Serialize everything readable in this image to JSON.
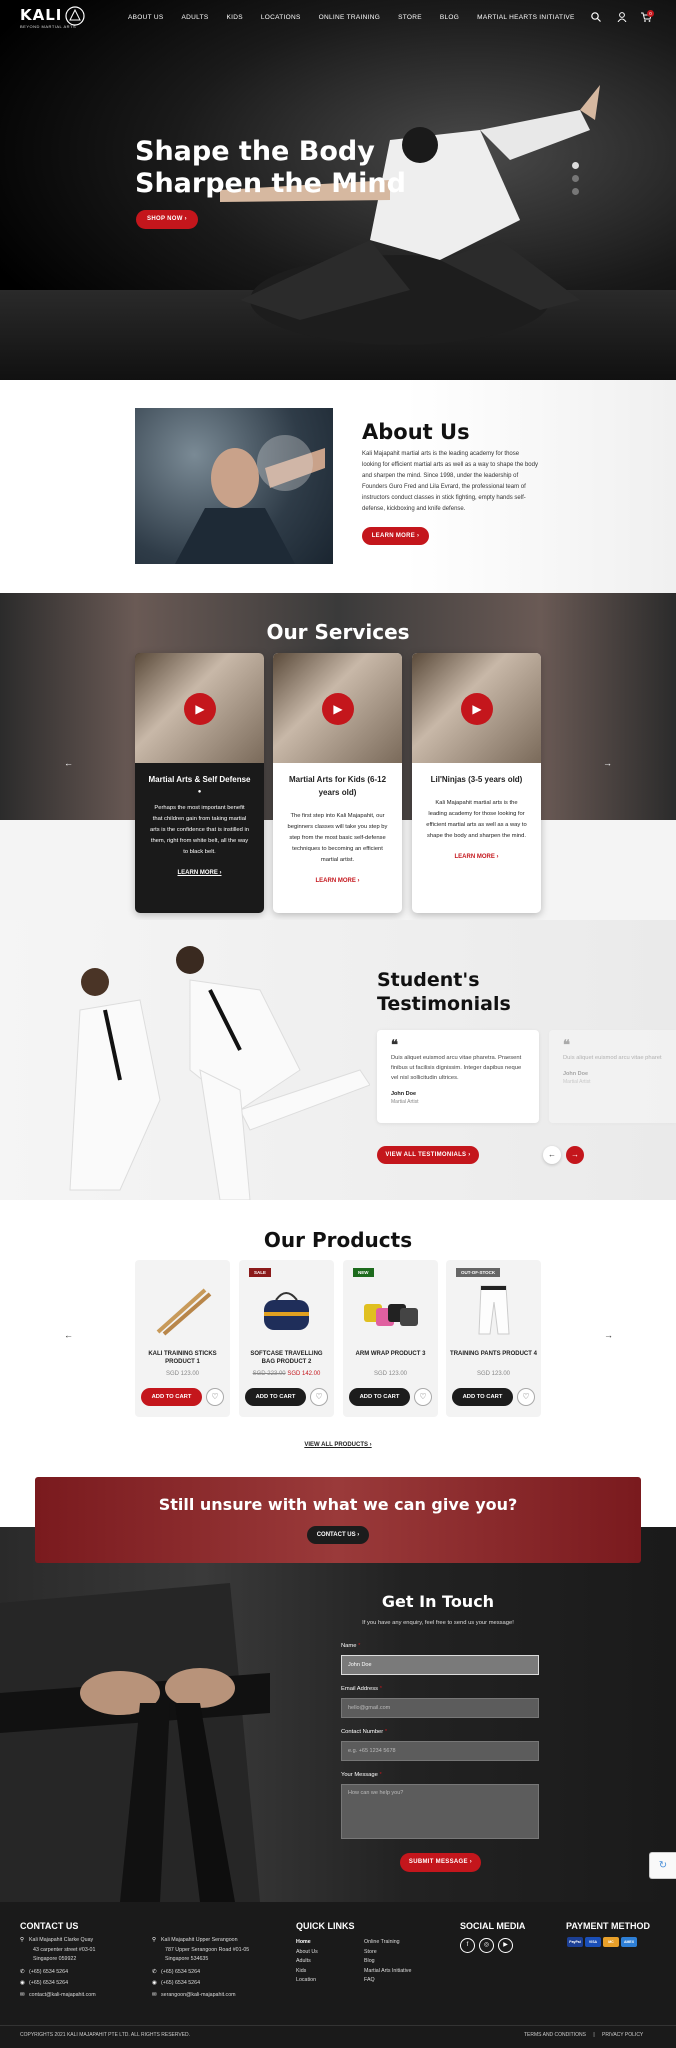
{
  "header": {
    "logo_main": "KALI",
    "logo_sub": "BEYOND MARTIAL ARTS",
    "nav": [
      "ABOUT US",
      "ADULTS",
      "KIDS",
      "LOCATIONS",
      "ONLINE TRAINING",
      "STORE",
      "BLOG",
      "MARTIAL HEARTS INITIATIVE"
    ],
    "cart_count": "0",
    "icons": [
      "search-icon",
      "user-icon",
      "cart-icon"
    ]
  },
  "hero": {
    "title_line1": "Shape the Body",
    "title_line2": "Sharpen the Mind",
    "button": "SHOP NOW ›"
  },
  "about": {
    "title": "About Us",
    "text": "Kali Majapahit martial arts is the leading academy for those looking for efficient martial arts as well as a way to shape the body and sharpen the mind. Since 1998, under the leadership of Founders Guro Fred and Lila Evrard, the professional team of instructors conduct classes in stick fighting, empty hands self-defense, kickboxing and knife defense.",
    "button": "LEARN MORE ›"
  },
  "services": {
    "title": "Our Services",
    "cards": [
      {
        "title": "Martial Arts & Self Defense",
        "text": "Perhaps the most important benefit that children gain from taking martial arts is the confidence that is instilled in them, right from white belt, all the way to black belt.",
        "link": "LEARN MORE ›"
      },
      {
        "title": "Martial Arts for Kids (6-12 years old)",
        "text": "The first step into Kali Majapahit, our beginners classes will take you step by step from the most basic self-defense techniques to becoming an efficient martial artist.",
        "link": "LEARN MORE ›"
      },
      {
        "title": "Lil'Ninjas (3-5 years old)",
        "text": "Kali Majapahit martial arts is the leading academy for those looking for efficient martial arts as well as a way to shape the body and sharpen the mind.",
        "link": "LEARN MORE ›"
      }
    ]
  },
  "testimonials": {
    "title": "Student's Testimonials",
    "items": [
      {
        "text": "Duis aliquet euismod arcu vitae pharetra. Praesent finibus ut facilisis dignissim. Integer dapibus neque vel nisl sollicitudin ultrices.",
        "name": "John Doe",
        "role": "Martial Artist"
      },
      {
        "text": "Duis aliquet euismod arcu vitae pharetra. Praesent finibus ut facilisis dignissim. Integer dapibus neque vel nisl sollicitudin ultrices.",
        "name": "John Doe",
        "role": "Martial Artist"
      }
    ],
    "button": "VIEW ALL TESTIMONIALS ›"
  },
  "products": {
    "title": "Our Products",
    "items": [
      {
        "name": "KALI TRAINING STICKS PRODUCT 1",
        "badge": "",
        "old_price": "",
        "price": "SGD 123.00",
        "button": "ADD TO CART"
      },
      {
        "name": "SOFTCASE TRAVELLING BAG PRODUCT 2",
        "badge": "SALE",
        "old_price": "SGD 223.00",
        "price": "SGD 142.00",
        "button": "ADD TO CART"
      },
      {
        "name": "ARM WRAP PRODUCT 3",
        "badge": "NEW",
        "old_price": "",
        "price": "SGD 123.00",
        "button": "ADD TO CART"
      },
      {
        "name": "TRAINING PANTS PRODUCT 4",
        "badge": "OUT-OF-STOCK",
        "old_price": "",
        "price": "SGD 123.00",
        "button": "ADD TO CART"
      }
    ],
    "view_all": "VIEW ALL PRODUCTS ›"
  },
  "cta": {
    "title": "Still unsure with what we can give you?",
    "button": "CONTACT US ›"
  },
  "contact": {
    "title": "Get In Touch",
    "subtitle": "If you have any enquiry, feel free to send us your message!",
    "name_label": "Name",
    "name_value": "John Doe",
    "email_label": "Email Address",
    "email_placeholder": "hello@gmail.com",
    "phone_label": "Contact Number",
    "phone_placeholder": "e.g. +65 1234 5678",
    "message_label": "Your Message",
    "message_placeholder": "How can we help you?",
    "submit": "SUBMIT MESSAGE ›",
    "required": "*"
  },
  "footer": {
    "contact_title": "CONTACT US",
    "loc1": [
      "Kali Majapahit Clarke Quay",
      "43 carpenter street #03-01",
      "Singapore 059922"
    ],
    "loc1_phone": "(+65) 6534 5264",
    "loc1_whatsapp": "(+65) 6534 5264",
    "loc1_email": "contact@kali-majapahit.com",
    "loc2": [
      "Kali Majapahit Upper Serangoon",
      "787 Upper Serangoon Road #01-05",
      "Singapore 534635"
    ],
    "loc2_phone": "(+65) 6534 5264",
    "loc2_whatsapp": "(+65) 6534 5264",
    "loc2_email": "serangoon@kali-majapahit.com",
    "quick_title": "QUICK LINKS",
    "quick_col1": [
      "Home",
      "About Us",
      "Adults",
      "Kids",
      "Location"
    ],
    "quick_col2": [
      "Online Training",
      "Store",
      "Blog",
      "Martial Arts Initiative",
      "FAQ"
    ],
    "social_title": "SOCIAL MEDIA",
    "social": [
      "f",
      "◎",
      "▶"
    ],
    "payment_title": "PAYMENT METHOD",
    "payments": [
      "PayPal",
      "VISA",
      "MC",
      "AMEX"
    ],
    "copyright": "COPYRIGHTS 2021 KALI MAJAPAHIT PTE LTD. ALL RIGHTS RESERVED.",
    "terms": "TERMS AND CONDITIONS",
    "sep": "|",
    "privacy": "PRIVACY POLICY"
  }
}
